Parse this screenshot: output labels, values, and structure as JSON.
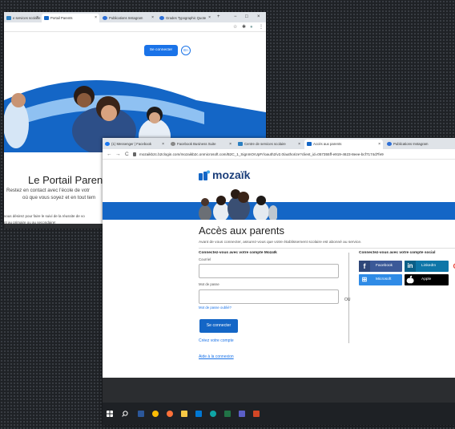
{
  "colors": {
    "brand_blue": "#1466c6",
    "link_blue": "#1a73e8",
    "facebook": "#3b5998",
    "linkedin": "#0e76a8",
    "microsoft": "#2f8be6",
    "apple": "#000000",
    "taskbar": "#1e2125"
  },
  "back_window": {
    "tabs": [
      {
        "label": "e services scolaire",
        "favicon": "portal-favicon"
      },
      {
        "label": "Portail Parents",
        "favicon": "mozaik-favicon"
      },
      {
        "label": "Publications Instagram",
        "favicon": "instagram-favicon"
      },
      {
        "label": "Grades Typographic Quote",
        "favicon": "chrome-favicon"
      }
    ],
    "new_tab": "+",
    "window_controls": {
      "minimize": "−",
      "maximize": "□",
      "close": "×"
    },
    "address_icons": {
      "star": "☆",
      "extensions": "✱",
      "profile": "●",
      "menu": "⋮"
    },
    "connect_button": "Se connecter",
    "lang_button": "En",
    "portal_title": "Le Portail Parent",
    "tagline_1": "Restez en contact avec l'école de votr",
    "tagline_2": "où que vous soyez et en tout tem",
    "body_1": "vous désirez pour faire le suivi de la réussite de vo",
    "body_2": "nt au primaire ou au secondaire!"
  },
  "front_window": {
    "tabs": [
      {
        "label": "(1) Messenger | Facebook",
        "favicon": "messenger-favicon"
      },
      {
        "label": "Facebook Business Suite",
        "favicon": "facebook-favicon"
      },
      {
        "label": "Centre de services scolaire",
        "favicon": "portal-favicon"
      },
      {
        "label": "Accès aux parents",
        "favicon": "mozaik-favicon"
      },
      {
        "label": "Publications Instagram",
        "favicon": "instagram-favicon"
      }
    ],
    "nav": {
      "back": "←",
      "forward": "→",
      "reload": "C"
    },
    "url": "mozaikb2c.b2clogin.com/mozaikb2c.onmicrosoft.com/B2C_1_SignInOrUpFr/oauth2/v2.0/authorize?client_id=057355ff-e919-4623-8eee-bcf7174d7fe9",
    "logo_text": "mozaïk",
    "page_title": "Accès aux parents",
    "intro": "Avant de vous connecter, assurez-vous que votre établissement scolaire est abonné au service.",
    "mozaik_heading": "Connectez-vous avec votre compte Mozaïk",
    "email_label": "Courriel",
    "email_value": "",
    "password_label": "Mot de passe",
    "password_value": "",
    "forgot_password": "Mot de passe oublié?",
    "connect_button": "Se connecter",
    "create_account": "Créez votre compte",
    "help_link": "Aide à la connexion",
    "or_label": "OU",
    "social_heading": "Connectez-vous avec votre compte social",
    "social": {
      "facebook": {
        "icon": "facebook-icon",
        "glyph": "f",
        "label": "Facebook"
      },
      "linkedin": {
        "icon": "linkedin-icon",
        "glyph": "in",
        "label": "LinkedIn"
      },
      "google": {
        "icon": "google-icon",
        "glyph": "G"
      },
      "microsoft": {
        "icon": "microsoft-icon",
        "glyph": "⊞",
        "label": "Microsoft"
      },
      "apple": {
        "icon": "apple-icon",
        "glyph": "",
        "label": "Apple"
      }
    }
  },
  "taskbar": {
    "start_icon": "windows-start-icon",
    "search_icon": "search-icon",
    "apps": [
      {
        "icon": "word-icon",
        "color": "#2b579a"
      },
      {
        "icon": "chrome-icon",
        "color": "#fbbc05"
      },
      {
        "icon": "firefox-icon",
        "color": "#ff7139"
      },
      {
        "icon": "file-explorer-icon",
        "color": "#f8c845"
      },
      {
        "icon": "outlook-icon",
        "color": "#0078d4"
      },
      {
        "icon": "edge-icon",
        "color": "#0fa5a5"
      },
      {
        "icon": "excel-icon",
        "color": "#217346"
      },
      {
        "icon": "teams-icon",
        "color": "#5b5fc7"
      },
      {
        "icon": "powerpoint-icon",
        "color": "#d24726"
      }
    ]
  }
}
